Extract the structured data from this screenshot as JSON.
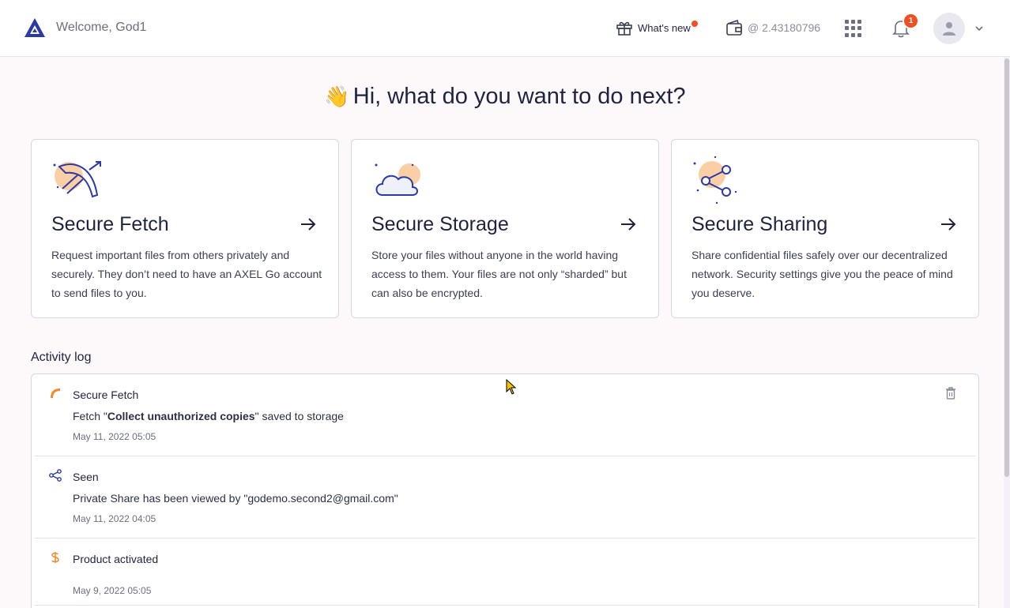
{
  "header": {
    "welcome": "Welcome, God1",
    "whats_new": "What's new",
    "wallet_balance": "@ 2.43180796",
    "notification_count": "1"
  },
  "greeting": {
    "emoji": "👋",
    "text": "Hi, what do you want to do next?"
  },
  "cards": [
    {
      "title": "Secure Fetch",
      "description": "Request important files from others privately and securely. They don’t need to have an AXEL Go account to send files to you."
    },
    {
      "title": "Secure Storage",
      "description": "Store your files without anyone in the world having access to them. Your files are not only “sharded” but can also be encrypted."
    },
    {
      "title": "Secure Sharing",
      "description": "Share confidential files safely over our decentralized network. Security settings give you the peace of mind you deserve."
    }
  ],
  "activity": {
    "title": "Activity log",
    "entries": [
      {
        "title": "Secure Fetch",
        "message_prefix": "Fetch \"",
        "message_bold": "Collect unauthorized copies",
        "message_suffix": "\" saved to storage",
        "date": "May 11, 2022 05:05"
      },
      {
        "title": "Seen",
        "message": "Private Share has been viewed by \"godemo.second2@gmail.com\"",
        "date": "May 11, 2022 04:05"
      },
      {
        "title": "Product activated",
        "date": "May 9, 2022 05:05"
      }
    ]
  },
  "colors": {
    "brand": "#2b3aa8",
    "accent_orange": "#f28c28",
    "badge_red": "#f04e23",
    "illustration_peach": "#fbcfa5"
  }
}
